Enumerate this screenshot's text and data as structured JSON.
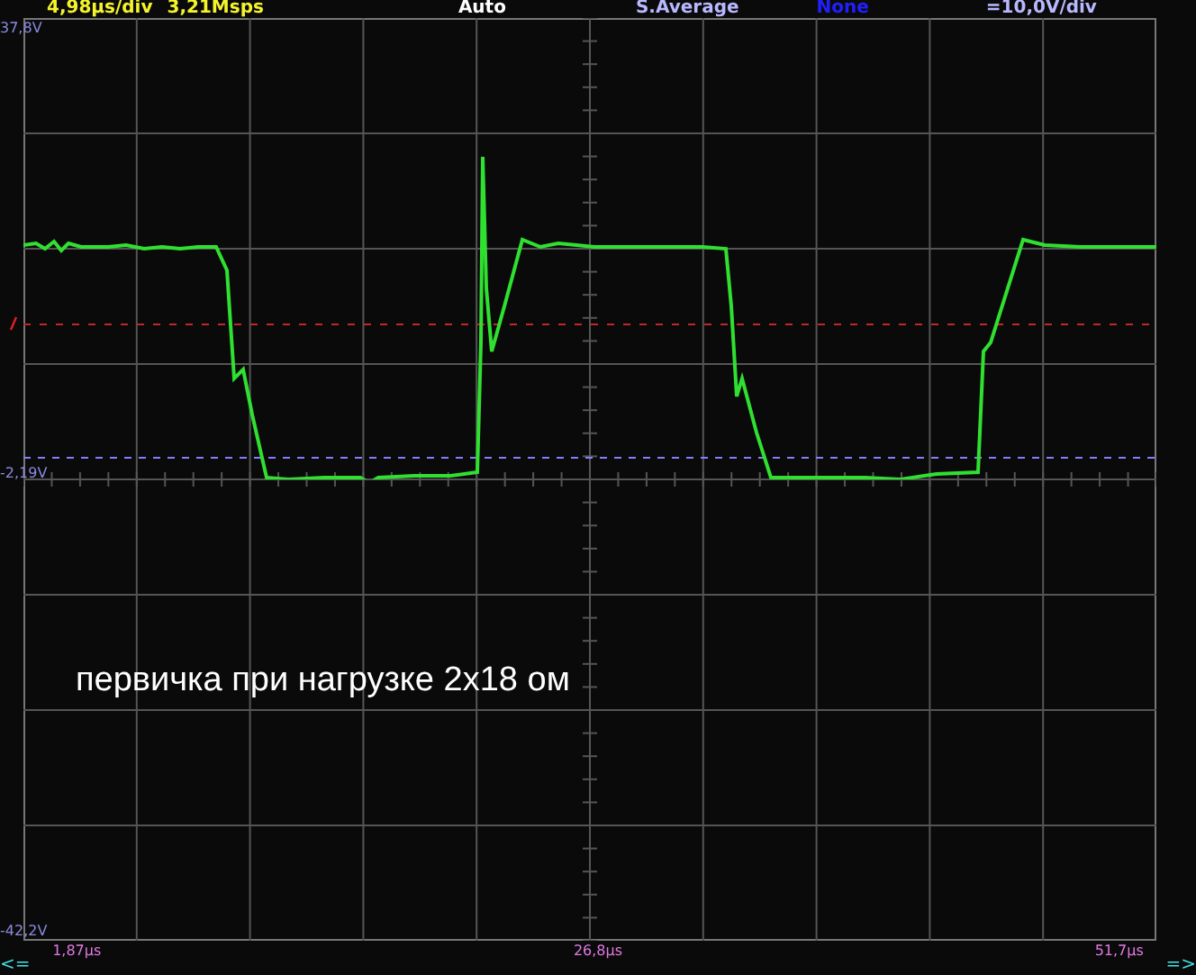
{
  "status_bar": {
    "timebase": "4,98µs/div",
    "sample_rate": "3,21Msps",
    "trigger_mode": "Auto",
    "acquisition": "S.Average",
    "math": "None",
    "channel_scale": "=10,0V/div"
  },
  "axis": {
    "top": "37,8V",
    "marker": "-2,19V",
    "bottom": "-42,2V"
  },
  "annotation": "первичка при нагрузке 2x18 ом",
  "time_axis": {
    "scroll_left": "<=",
    "start": "1,87µs",
    "center": "26,8µs",
    "end": "51,7µs",
    "scroll_right": "=>"
  }
}
